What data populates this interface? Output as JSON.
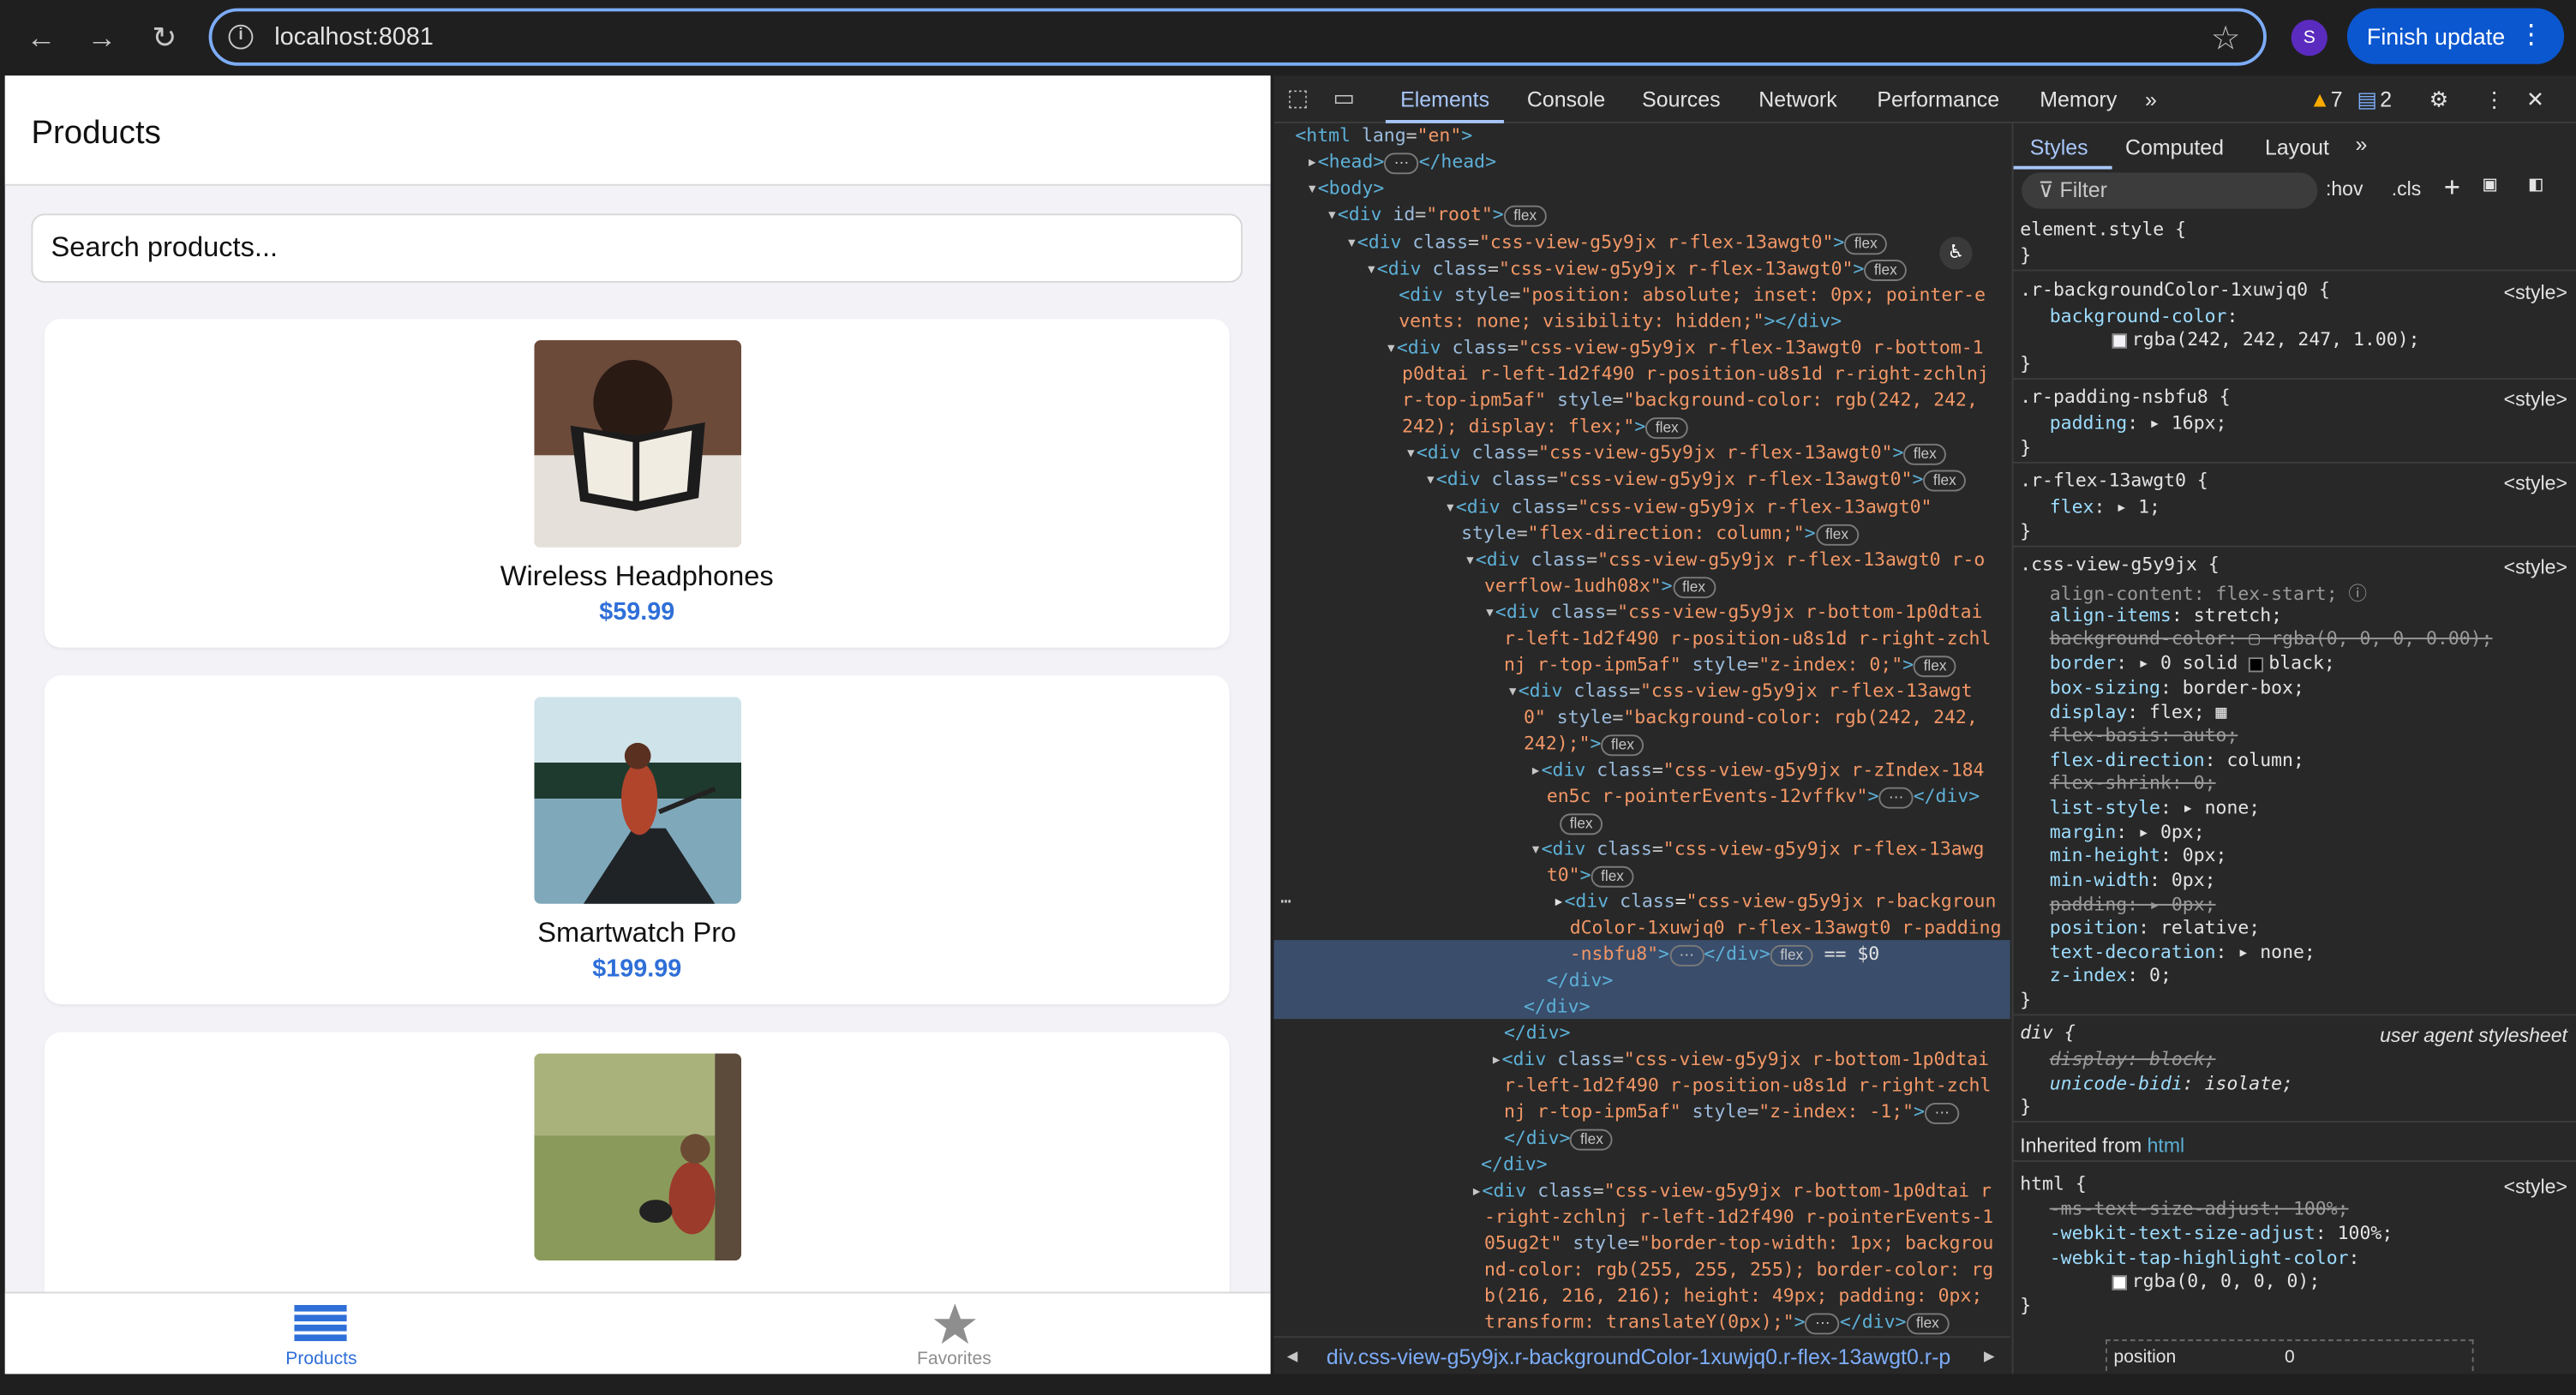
{
  "browser": {
    "url": "localhost:8081",
    "profile_initial": "S",
    "update_label": "Finish update"
  },
  "app": {
    "title": "Products",
    "search_placeholder": "Search products...",
    "products": [
      {
        "name": "Wireless Headphones",
        "price": "$59.99"
      },
      {
        "name": "Smartwatch Pro",
        "price": "$199.99"
      },
      {
        "name": "",
        "price": ""
      }
    ],
    "tabs": [
      {
        "label": "Products",
        "active": true
      },
      {
        "label": "Favorites",
        "active": false
      }
    ],
    "accent_color": "#2f6fd8"
  },
  "devtools": {
    "tabs": [
      "Elements",
      "Console",
      "Sources",
      "Network",
      "Performance",
      "Memory"
    ],
    "warnings": "7",
    "messages": "2",
    "style_tabs": [
      "Styles",
      "Computed",
      "Layout"
    ],
    "filter_placeholder": "Filter",
    "hov": ":hov",
    "cls": ".cls",
    "breadcrumb": "div.css-view-g5y9jx.r-backgroundColor-1xuwjq0.r-flex-13awgt0.r-p",
    "box_model_label": "position",
    "box_model_value": "0"
  }
}
